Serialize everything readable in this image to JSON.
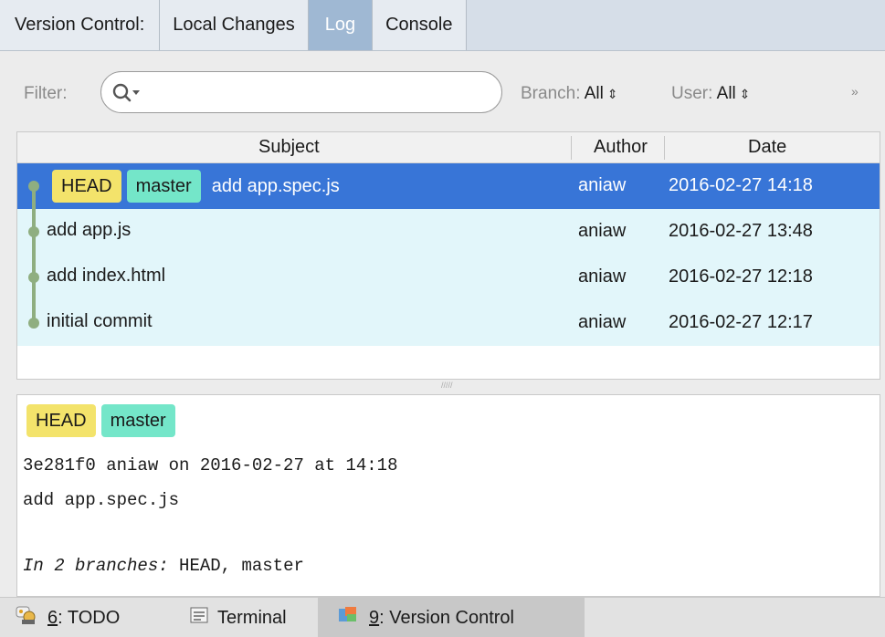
{
  "tabs": {
    "title": "Version Control:",
    "items": [
      "Local Changes",
      "Log",
      "Console"
    ],
    "active": "Log"
  },
  "filter": {
    "label": "Filter:",
    "search_value": "",
    "branch_label": "Branch:",
    "branch_value": "All",
    "user_label": "User:",
    "user_value": "All",
    "more": "»"
  },
  "table": {
    "columns": [
      "Subject",
      "Author",
      "Date"
    ],
    "rows": [
      {
        "refs": [
          "HEAD",
          "master"
        ],
        "subject": "add app.spec.js",
        "author": "aniaw",
        "date": "2016-02-27 14:18",
        "selected": true
      },
      {
        "refs": [],
        "subject": "add app.js",
        "author": "aniaw",
        "date": "2016-02-27 13:48",
        "selected": false
      },
      {
        "refs": [],
        "subject": "add index.html",
        "author": "aniaw",
        "date": "2016-02-27 12:18",
        "selected": false
      },
      {
        "refs": [],
        "subject": "initial commit",
        "author": "aniaw",
        "date": "2016-02-27 12:17",
        "selected": false
      }
    ]
  },
  "details": {
    "refs": [
      "HEAD",
      "master"
    ],
    "line1": "3e281f0 aniaw on 2016-02-27 at 14:18",
    "line2": "add app.spec.js",
    "branches_prefix": "In 2 branches:",
    "branches_list": "HEAD, master"
  },
  "bottom": {
    "todo_key": "6",
    "todo_label": ": TODO",
    "terminal": "Terminal",
    "vc_key": "9",
    "vc_label": ": Version Control"
  },
  "colors": {
    "selection": "#3875d7",
    "row_bg": "#e2f6fa",
    "head_badge": "#f3e36b",
    "master_badge": "#74e6c9",
    "active_tab": "#9fb8d3",
    "graph": "#8fae80"
  }
}
